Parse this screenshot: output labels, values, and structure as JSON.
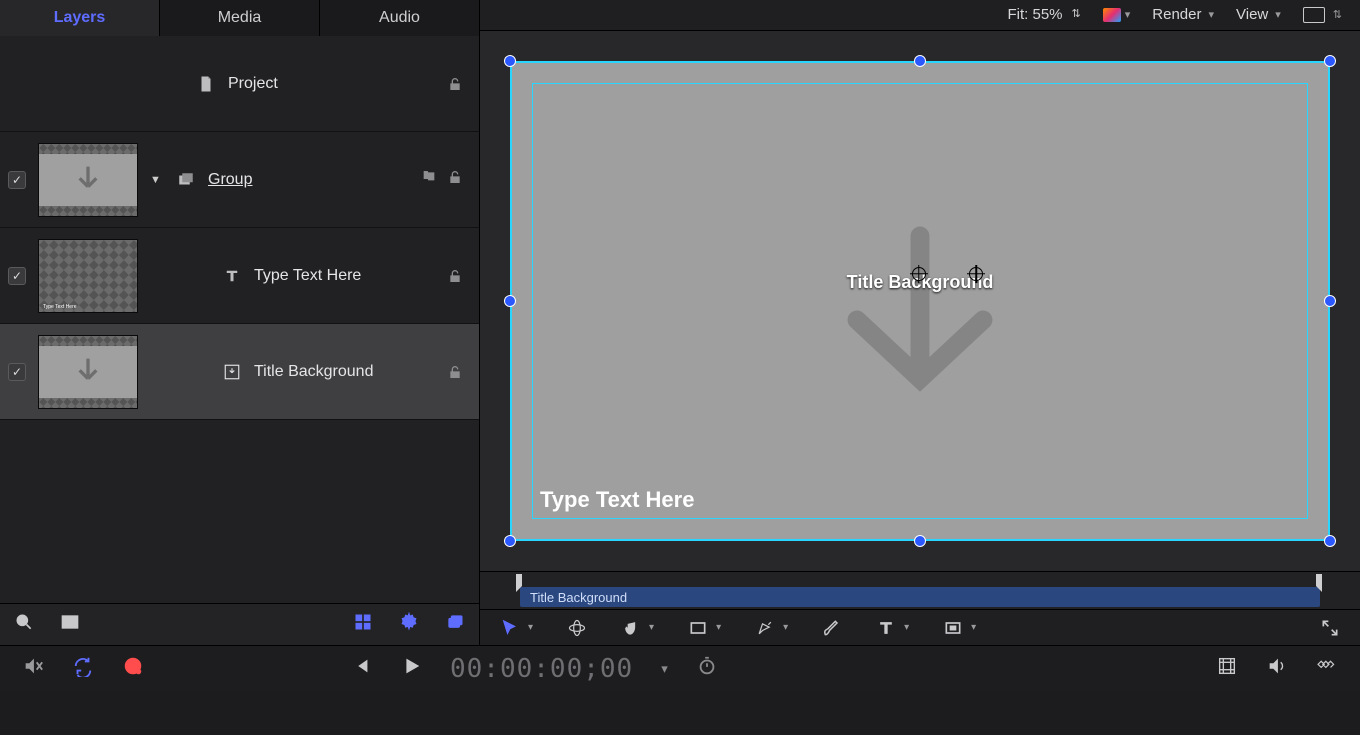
{
  "sidebar": {
    "tabs": {
      "layers": "Layers",
      "media": "Media",
      "audio": "Audio"
    },
    "rows": {
      "project": "Project",
      "group": "Group",
      "text": "Type Text Here",
      "title_bg": "Title Background"
    }
  },
  "canvas": {
    "fit_label": "Fit: 55%",
    "render_label": "Render",
    "view_label": "View",
    "label_title_bg": "Title Background",
    "type_text": "Type Text Here"
  },
  "mini_timeline": {
    "clip_label": "Title Background"
  },
  "transport": {
    "timecode": "00:00:00;00"
  }
}
